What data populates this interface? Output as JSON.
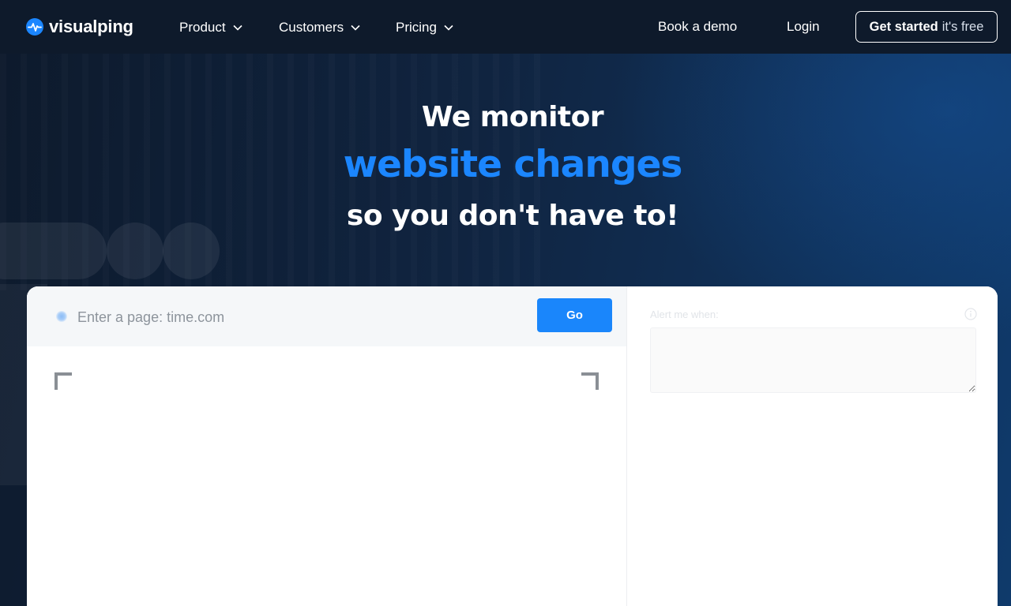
{
  "brand": {
    "name": "visualping",
    "logo_icon": "pulse-heartbeat-icon",
    "accent_color": "#1b86ff"
  },
  "nav": {
    "menus": [
      {
        "label": "Product",
        "icon": "chevron-down-icon"
      },
      {
        "label": "Customers",
        "icon": "chevron-down-icon"
      },
      {
        "label": "Pricing",
        "icon": "chevron-down-icon"
      }
    ],
    "book_demo": "Book a demo",
    "login": "Login",
    "cta_strong": "Get started",
    "cta_light": "it's free"
  },
  "hero": {
    "line1": "We monitor",
    "line2": "website changes",
    "line3": "so you don't have to!"
  },
  "monitor": {
    "url_placeholder": "Enter a page: time.com",
    "url_value": "",
    "go_label": "Go",
    "alert_label": "Alert me when:",
    "alert_value": "",
    "info_icon": "info-circle-icon"
  }
}
